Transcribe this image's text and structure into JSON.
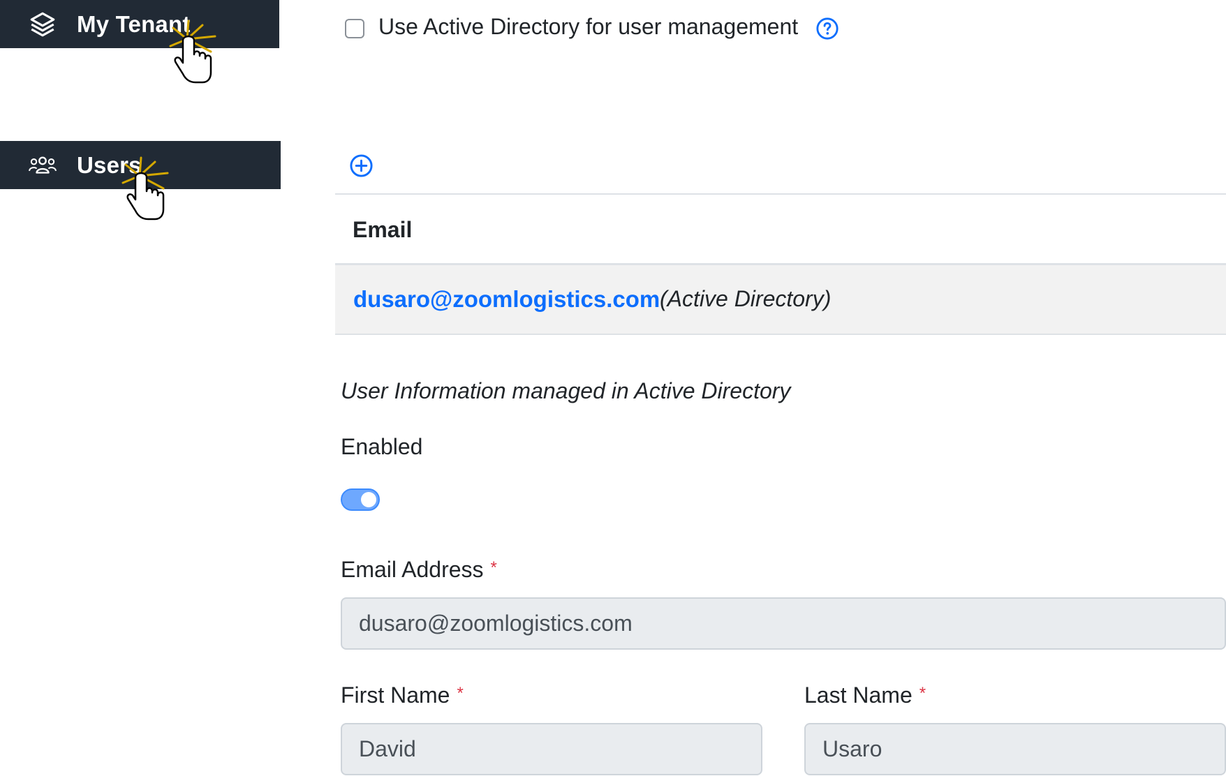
{
  "sidebar": {
    "items": [
      {
        "label": "My Tenant",
        "icon": "layers-icon"
      },
      {
        "label": "Users",
        "icon": "users-icon"
      }
    ]
  },
  "settings": {
    "use_ad_label": "Use Active Directory for user management",
    "use_ad_checked": false
  },
  "users_table": {
    "column_email": "Email",
    "rows": [
      {
        "email": "dusaro@zoomlogistics.com",
        "source": "(Active Directory)"
      }
    ]
  },
  "user_form": {
    "managed_note": "User Information managed in Active Directory",
    "enabled_label": "Enabled",
    "enabled": true,
    "email_label": "Email Address",
    "email_value": "dusaro@zoomlogistics.com",
    "first_name_label": "First Name",
    "first_name_value": "David",
    "last_name_label": "Last Name",
    "last_name_value": "Usaro",
    "required_marker": "*"
  },
  "colors": {
    "sidebar_bg": "#212a35",
    "link_blue": "#0d6efd",
    "required_red": "#dc3545"
  }
}
